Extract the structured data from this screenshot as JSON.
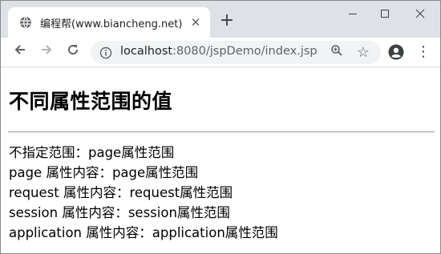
{
  "browser": {
    "tab": {
      "title": "编程帮(www.biancheng.net)",
      "favicon": "globe-icon",
      "close_glyph": "✕"
    },
    "new_tab_glyph": "+",
    "window_controls": {
      "minimize": "─",
      "maximize": "☐",
      "close": "✕"
    },
    "toolbar": {
      "back_glyph": "←",
      "forward_glyph": "→",
      "reload_glyph": "↻",
      "menu_glyph": "⋮"
    },
    "address": {
      "host": "localhost",
      "path": ":8080/jspDemo/index.jsp",
      "info_icon": "info-icon",
      "zoom_icon": "zoom-icon",
      "bookmark_glyph": "☆",
      "profile_icon": "profile-icon"
    }
  },
  "page": {
    "heading": "不同属性范围的值",
    "lines": [
      "不指定范围：page属性范围",
      "page 属性内容：page属性范围",
      "request 属性内容：request属性范围",
      "session 属性内容：session属性范围",
      "application 属性内容：application属性范围"
    ]
  },
  "colors": {
    "tabstrip": "#dee1e6",
    "omnibox": "#f1f3f4",
    "icon": "#5f6368",
    "text": "#202124"
  }
}
